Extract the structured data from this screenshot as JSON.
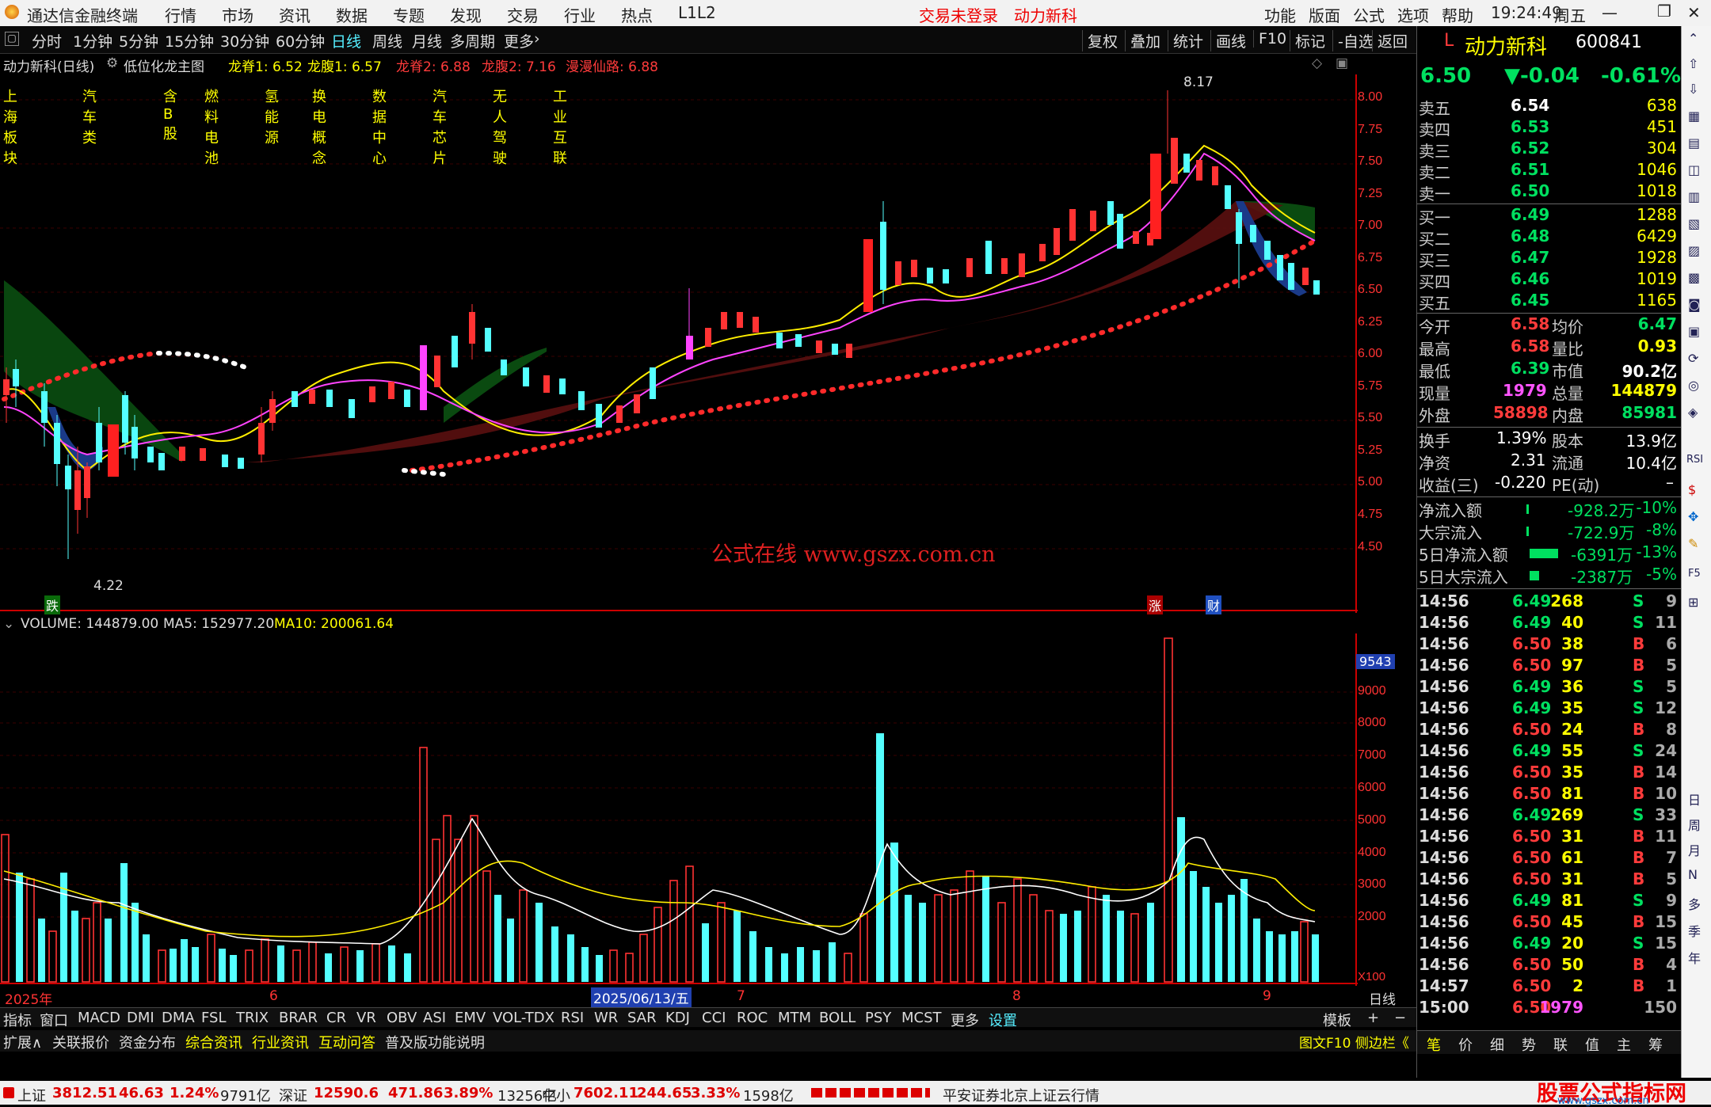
{
  "menubar": {
    "app_title": "通达信金融终端",
    "menus": [
      "行情",
      "市场",
      "资讯",
      "数据",
      "专题",
      "发现",
      "交易",
      "行业",
      "热点",
      "L1L2"
    ],
    "login": "交易未登录",
    "stock_name": "动力新科",
    "right_menus": [
      "功能",
      "版面",
      "公式",
      "选项",
      "帮助"
    ],
    "time": "19:24:49",
    "weekday": "周五"
  },
  "periods": [
    "分时",
    "1分钟",
    "5分钟",
    "15分钟",
    "30分钟",
    "60分钟",
    "日线",
    "周线",
    "月线",
    "多周期",
    "更多"
  ],
  "period_active": "日线",
  "tools": [
    "复权",
    "叠加",
    "统计",
    "画线",
    "F10",
    "标记",
    "-自选",
    "返回"
  ],
  "chart_title": {
    "name": "动力新科(日线)",
    "formula": "低位化龙主图",
    "ind1": "龙脊1: 6.52",
    "ind2": "龙腹1: 6.57",
    "ind3": "龙脊2: 6.88",
    "ind4": "龙腹2: 7.16",
    "ind5": "漫漫仙路: 6.88"
  },
  "blocks": [
    "上海板块",
    "汽车类",
    "含B股",
    "燃料电池",
    "氢能源",
    "换电概念",
    "数据中心",
    "汽车芯片",
    "无人驾驶",
    "工业互联"
  ],
  "price_axis": [
    "8.00",
    "7.75",
    "7.50",
    "7.25",
    "7.00",
    "6.75",
    "6.50",
    "6.25",
    "6.00",
    "5.75",
    "5.50",
    "5.25",
    "5.00",
    "4.75",
    "4.50"
  ],
  "price_annotations": {
    "high": "8.17",
    "low": "4.22",
    "fall_tag": "跌",
    "rise_tag": "涨",
    "fin_tag": "财"
  },
  "watermark": "公式在线 www.gszx.com.cn",
  "volume_title": {
    "vol": "VOLUME: 144879.00",
    "ma5": "MA5: 152977.20",
    "ma10": "MA10: 200061.64"
  },
  "volume_axis": [
    "9000",
    "8000",
    "7000",
    "6000",
    "5000",
    "4000",
    "3000",
    "2000"
  ],
  "volume_marker": "9543",
  "volume_unit": "X100",
  "date_axis": {
    "year": "2025年",
    "m6": "6",
    "cursor": "2025/06/13/五",
    "m7": "7",
    "m8": "8",
    "m9": "9",
    "period": "日线"
  },
  "indicator_tabs": [
    "指标",
    "窗口",
    "MACD",
    "DMI",
    "DMA",
    "FSL",
    "TRIX",
    "BRAR",
    "CR",
    "VR",
    "OBV",
    "ASI",
    "EMV",
    "VOL-TDX",
    "RSI",
    "WR",
    "SAR",
    "KDJ",
    "CCI",
    "ROC",
    "MTM",
    "BOLL",
    "PSY",
    "MCST",
    "更多",
    "设置"
  ],
  "template_btn": "模板",
  "info_tabs": [
    "扩展∧",
    "关联报价",
    "资金分布",
    "综合资讯",
    "行业资讯",
    "互动问答",
    "普及版功能说明"
  ],
  "info_right": "图文F10 侧边栏《",
  "quote": {
    "flag": "L",
    "name": "动力新科",
    "code": "600841",
    "price": "6.50",
    "change": "▼-0.04",
    "pct": "-0.61%"
  },
  "asks": [
    {
      "label": "卖五",
      "price": "6.54",
      "vol": "638"
    },
    {
      "label": "卖四",
      "price": "6.53",
      "vol": "451"
    },
    {
      "label": "卖三",
      "price": "6.52",
      "vol": "304"
    },
    {
      "label": "卖二",
      "price": "6.51",
      "vol": "1046"
    },
    {
      "label": "卖一",
      "price": "6.50",
      "vol": "1018"
    }
  ],
  "bids": [
    {
      "label": "买一",
      "price": "6.49",
      "vol": "1288"
    },
    {
      "label": "买二",
      "price": "6.48",
      "vol": "6429"
    },
    {
      "label": "买三",
      "price": "6.47",
      "vol": "1928"
    },
    {
      "label": "买四",
      "price": "6.46",
      "vol": "1019"
    },
    {
      "label": "买五",
      "price": "6.45",
      "vol": "1165"
    }
  ],
  "stats": [
    {
      "l1": "今开",
      "v1": "6.58",
      "l2": "均价",
      "v2": "6.47"
    },
    {
      "l1": "最高",
      "v1": "6.58",
      "l2": "量比",
      "v2": "0.93"
    },
    {
      "l1": "最低",
      "v1": "6.39",
      "l2": "市值",
      "v2": "90.2亿"
    },
    {
      "l1": "现量",
      "v1": "1979",
      "l2": "总量",
      "v2": "144879"
    },
    {
      "l1": "外盘",
      "v1": "58898",
      "l2": "内盘",
      "v2": "85981"
    }
  ],
  "stats2": [
    {
      "l1": "换手",
      "v1": "1.39%",
      "l2": "股本",
      "v2": "13.9亿"
    },
    {
      "l1": "净资",
      "v1": "2.31",
      "l2": "流通",
      "v2": "10.4亿"
    },
    {
      "l1": "收益(三)",
      "v1": "-0.220",
      "l2": "PE(动)",
      "v2": "–"
    }
  ],
  "flows": [
    {
      "label": "净流入额",
      "value": "-928.2万",
      "pct": "-10%"
    },
    {
      "label": "大宗流入",
      "value": "-722.9万",
      "pct": "-8%"
    },
    {
      "label": "5日净流入额",
      "value": "-6391万",
      "pct": "-13%"
    },
    {
      "label": "5日大宗流入",
      "value": "-2387万",
      "pct": "-5%"
    }
  ],
  "ticks": [
    {
      "t": "14:56",
      "p": "6.49",
      "v": "268",
      "s": "S",
      "n": "9"
    },
    {
      "t": "14:56",
      "p": "6.49",
      "v": "40",
      "s": "S",
      "n": "11"
    },
    {
      "t": "14:56",
      "p": "6.50",
      "v": "38",
      "s": "B",
      "n": "6"
    },
    {
      "t": "14:56",
      "p": "6.50",
      "v": "97",
      "s": "B",
      "n": "5"
    },
    {
      "t": "14:56",
      "p": "6.49",
      "v": "36",
      "s": "S",
      "n": "5"
    },
    {
      "t": "14:56",
      "p": "6.49",
      "v": "35",
      "s": "S",
      "n": "12"
    },
    {
      "t": "14:56",
      "p": "6.50",
      "v": "24",
      "s": "B",
      "n": "8"
    },
    {
      "t": "14:56",
      "p": "6.49",
      "v": "55",
      "s": "S",
      "n": "24"
    },
    {
      "t": "14:56",
      "p": "6.50",
      "v": "35",
      "s": "B",
      "n": "14"
    },
    {
      "t": "14:56",
      "p": "6.50",
      "v": "81",
      "s": "B",
      "n": "10"
    },
    {
      "t": "14:56",
      "p": "6.49",
      "v": "269",
      "s": "S",
      "n": "33"
    },
    {
      "t": "14:56",
      "p": "6.50",
      "v": "31",
      "s": "B",
      "n": "11"
    },
    {
      "t": "14:56",
      "p": "6.50",
      "v": "61",
      "s": "B",
      "n": "7"
    },
    {
      "t": "14:56",
      "p": "6.50",
      "v": "31",
      "s": "B",
      "n": "5"
    },
    {
      "t": "14:56",
      "p": "6.49",
      "v": "81",
      "s": "S",
      "n": "9"
    },
    {
      "t": "14:56",
      "p": "6.50",
      "v": "45",
      "s": "B",
      "n": "15"
    },
    {
      "t": "14:56",
      "p": "6.49",
      "v": "20",
      "s": "S",
      "n": "15"
    },
    {
      "t": "14:56",
      "p": "6.50",
      "v": "50",
      "s": "B",
      "n": "4"
    },
    {
      "t": "14:57",
      "p": "6.50",
      "v": "2",
      "s": "B",
      "n": "1"
    },
    {
      "t": "15:00",
      "p": "6.50",
      "v": "1979",
      "s": "",
      "n": "150"
    }
  ],
  "right_tabs": [
    "笔",
    "价",
    "细",
    "势",
    "联",
    "值",
    "主",
    "筹"
  ],
  "side_labels": [
    "RSI",
    "F5",
    "日",
    "周",
    "月",
    "N",
    "多",
    "季",
    "年"
  ],
  "status": {
    "sh_label": "上证",
    "sh_val": "3812.51",
    "sh_chg": "46.63",
    "sh_pct": "1.24%",
    "sh_amt": "9791亿",
    "sz_label": "深证",
    "sz_val": "12590.6",
    "sz_chg": "471.86",
    "sz_pct": "3.89%",
    "sz_amt": "13256亿",
    "zx_label": "中小",
    "zx_val": "7602.11",
    "zx_chg": "244.65",
    "zx_pct": "3.33%",
    "zx_amt": "1598亿",
    "server": "平安证券北京上证云行情",
    "brand": "股票公式指标网",
    "brand_url": "www.gszx.com.cn"
  },
  "chart_data": {
    "type": "candlestick",
    "title": "动力新科(日线)",
    "y_range": [
      4.22,
      8.17
    ],
    "high": 8.17,
    "low": 4.22,
    "last_close": 6.5,
    "volume_max": 9543,
    "volume_ma5": 152977.2,
    "volume_ma10": 200061.64
  },
  "colors": {
    "up": "#ff3333",
    "down": "#54ffff",
    "bg": "#000000",
    "grid": "#3a0000",
    "ma_yellow": "#ffff00",
    "ma_magenta": "#ff44ff"
  }
}
